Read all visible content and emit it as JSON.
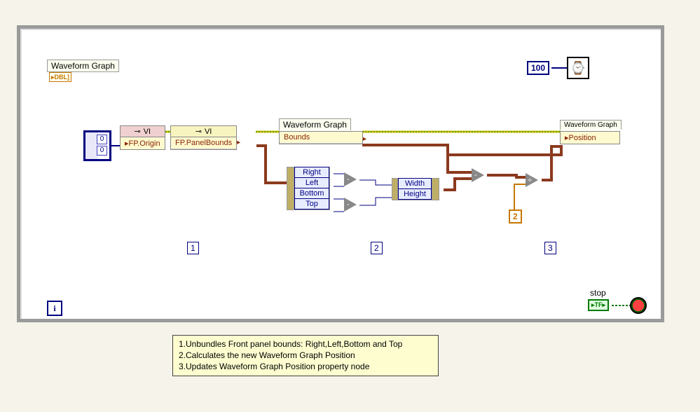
{
  "title_label": "Waveform Graph",
  "terminal_dbl": "DBL]",
  "constant_100": "100",
  "array_const": [
    "0",
    "0"
  ],
  "vi_node1": {
    "hdr": "VI",
    "row": "FP.Origin"
  },
  "vi_node2": {
    "hdr": "VI",
    "row": "FP.PanelBounds"
  },
  "wg_node1": {
    "hdr": "Waveform Graph",
    "row": "Bounds"
  },
  "wg_node2": {
    "hdr": "Waveform Graph",
    "row": "Position"
  },
  "unbundle": {
    "rows": [
      "Right",
      "Left",
      "Bottom",
      "Top"
    ]
  },
  "bundle": {
    "rows": [
      "Width",
      "Height"
    ]
  },
  "two_const": "2",
  "step1": "1",
  "step2": "2",
  "step3": "3",
  "stop_label": "stop",
  "tf": "TF",
  "footnotes": {
    "l1": "1.Unbundles Front panel bounds: Right,Left,Bottom and Top",
    "l2": "2.Calculates the new Waveform Graph Position",
    "l3": "3.Updates Waveform Graph Position property node"
  }
}
